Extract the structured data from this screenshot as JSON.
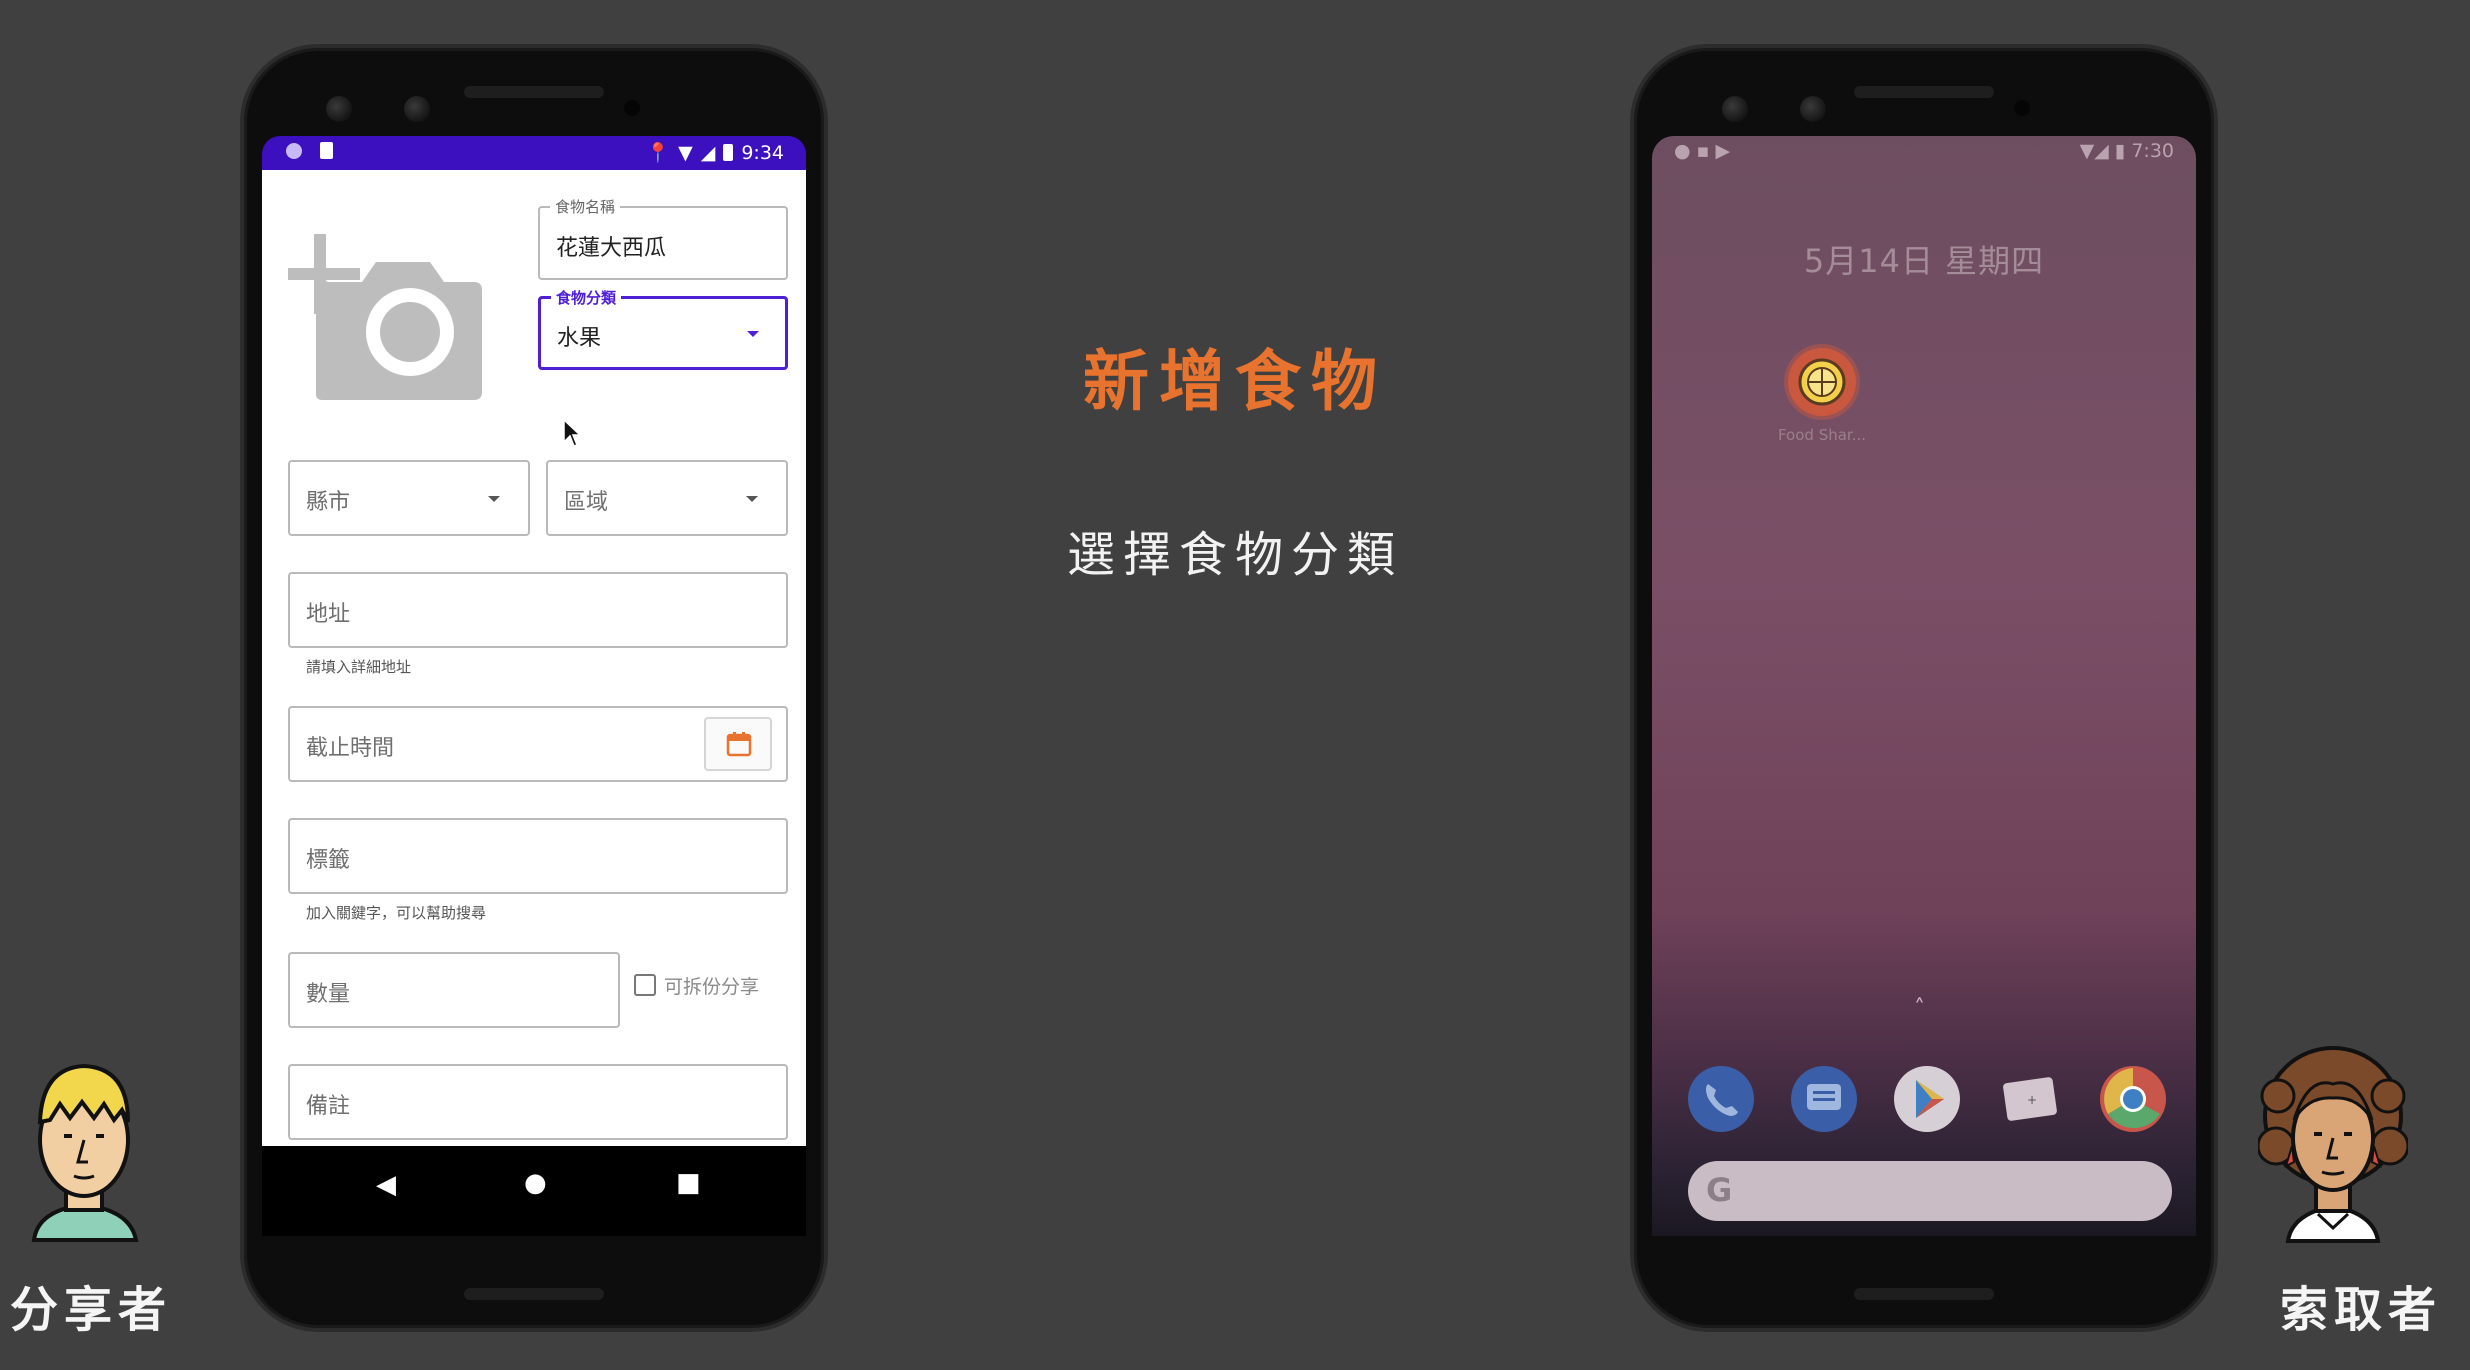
{
  "slide": {
    "title": "新增食物",
    "subtitle": "選擇食物分類",
    "left_role": "分享者",
    "right_role": "索取者",
    "accent_color": "#e8732e"
  },
  "left_phone": {
    "status_bar": {
      "time": "9:34",
      "color": "#3c0fbf"
    },
    "form": {
      "food_name": {
        "label": "食物名稱",
        "value": "花蓮大西瓜"
      },
      "food_category": {
        "label": "食物分類",
        "value": "水果"
      },
      "city": {
        "placeholder": "縣市"
      },
      "district": {
        "placeholder": "區域"
      },
      "address": {
        "placeholder": "地址",
        "helper": "請填入詳細地址"
      },
      "deadline": {
        "placeholder": "截止時間"
      },
      "tags": {
        "placeholder": "標籤",
        "helper": "加入關鍵字，可以幫助搜尋"
      },
      "quantity": {
        "placeholder": "數量"
      },
      "splittable": {
        "label": "可拆份分享",
        "checked": false
      },
      "notes": {
        "placeholder": "備註"
      }
    },
    "icons": {
      "photo": "add-photo-icon",
      "calendar": "calendar-icon"
    }
  },
  "right_phone": {
    "status_bar": {
      "time": "7:30"
    },
    "home": {
      "date": "5月14日 星期四",
      "app_label": "Food Shar...",
      "dock": [
        "phone-icon",
        "messages-icon",
        "play-store-icon",
        "camera-icon",
        "chrome-icon"
      ]
    }
  }
}
